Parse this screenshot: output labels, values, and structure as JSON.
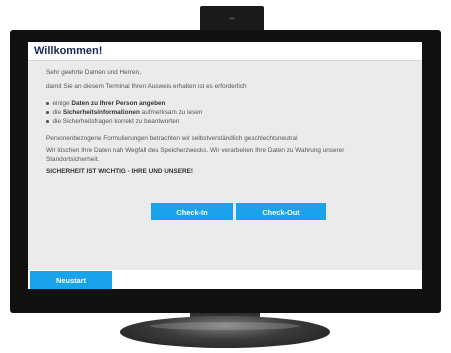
{
  "screen": {
    "title": "Willkommen!",
    "greeting": "Sehr geehrte Damen und Herren,",
    "intro": "damit Sie an diesem Terminal Ihren Ausweis erhalten ist es erforderlich",
    "bullets": [
      {
        "prefix": "einige ",
        "strong": "Daten zu Ihrer Person angeben",
        "suffix": ""
      },
      {
        "prefix": "die ",
        "strong": "Sicherheitsinformationen",
        "suffix": " aufmerksam zu lesen"
      },
      {
        "prefix": "die Sicherheitsfragen korrekt zu beantworten",
        "strong": "",
        "suffix": ""
      }
    ],
    "gender_note": "Personenbezogene Formulierungen betrachten wir selbstverständlich geschlechtsneutral",
    "privacy_line1": "Wir löschen Ihre Daten nah Wegfall des Speicherzwecks. Wir verarbeiten Ihre Daten zu Wahrung unserer",
    "privacy_line2": "Standortsicherheit.",
    "safety_slogan": "SICHERHEIT IST WICHTIG - IHRE UND UNSERE!",
    "checkin_label": "Check-In",
    "checkout_label": "Check-Out",
    "restart_label": "Neustart"
  },
  "colors": {
    "accent": "#1aa3ea",
    "title": "#1a2a56",
    "panel": "#ebebeb",
    "bezel": "#111111"
  }
}
